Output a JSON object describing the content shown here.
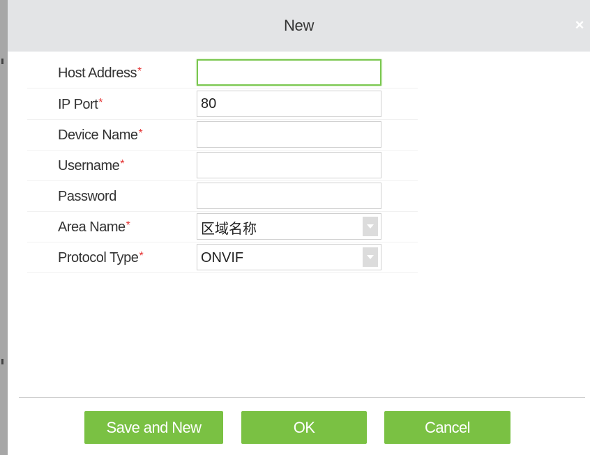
{
  "dialog": {
    "title": "New",
    "close_glyph": "×",
    "required_mark": "*"
  },
  "form": {
    "fields": [
      {
        "label": "Host Address",
        "required": true,
        "value": "",
        "type": "text"
      },
      {
        "label": "IP Port",
        "required": true,
        "value": "80",
        "type": "text"
      },
      {
        "label": "Device Name",
        "required": true,
        "value": "",
        "type": "text"
      },
      {
        "label": "Username",
        "required": true,
        "value": "",
        "type": "text"
      },
      {
        "label": "Password",
        "required": false,
        "value": "",
        "type": "password"
      },
      {
        "label": "Area Name",
        "required": true,
        "value": "区域名称",
        "type": "select"
      },
      {
        "label": "Protocol Type",
        "required": true,
        "value": "ONVIF",
        "type": "select"
      }
    ]
  },
  "buttons": {
    "save_and_new": "Save and New",
    "ok": "OK",
    "cancel": "Cancel"
  },
  "colors": {
    "accent": "#7ac143",
    "focus_border": "#7ac74f",
    "required": "#e53333",
    "titlebar": "#e3e4e6"
  },
  "icons": {
    "close": "close-icon",
    "dropdown": "chevron-down-icon"
  }
}
